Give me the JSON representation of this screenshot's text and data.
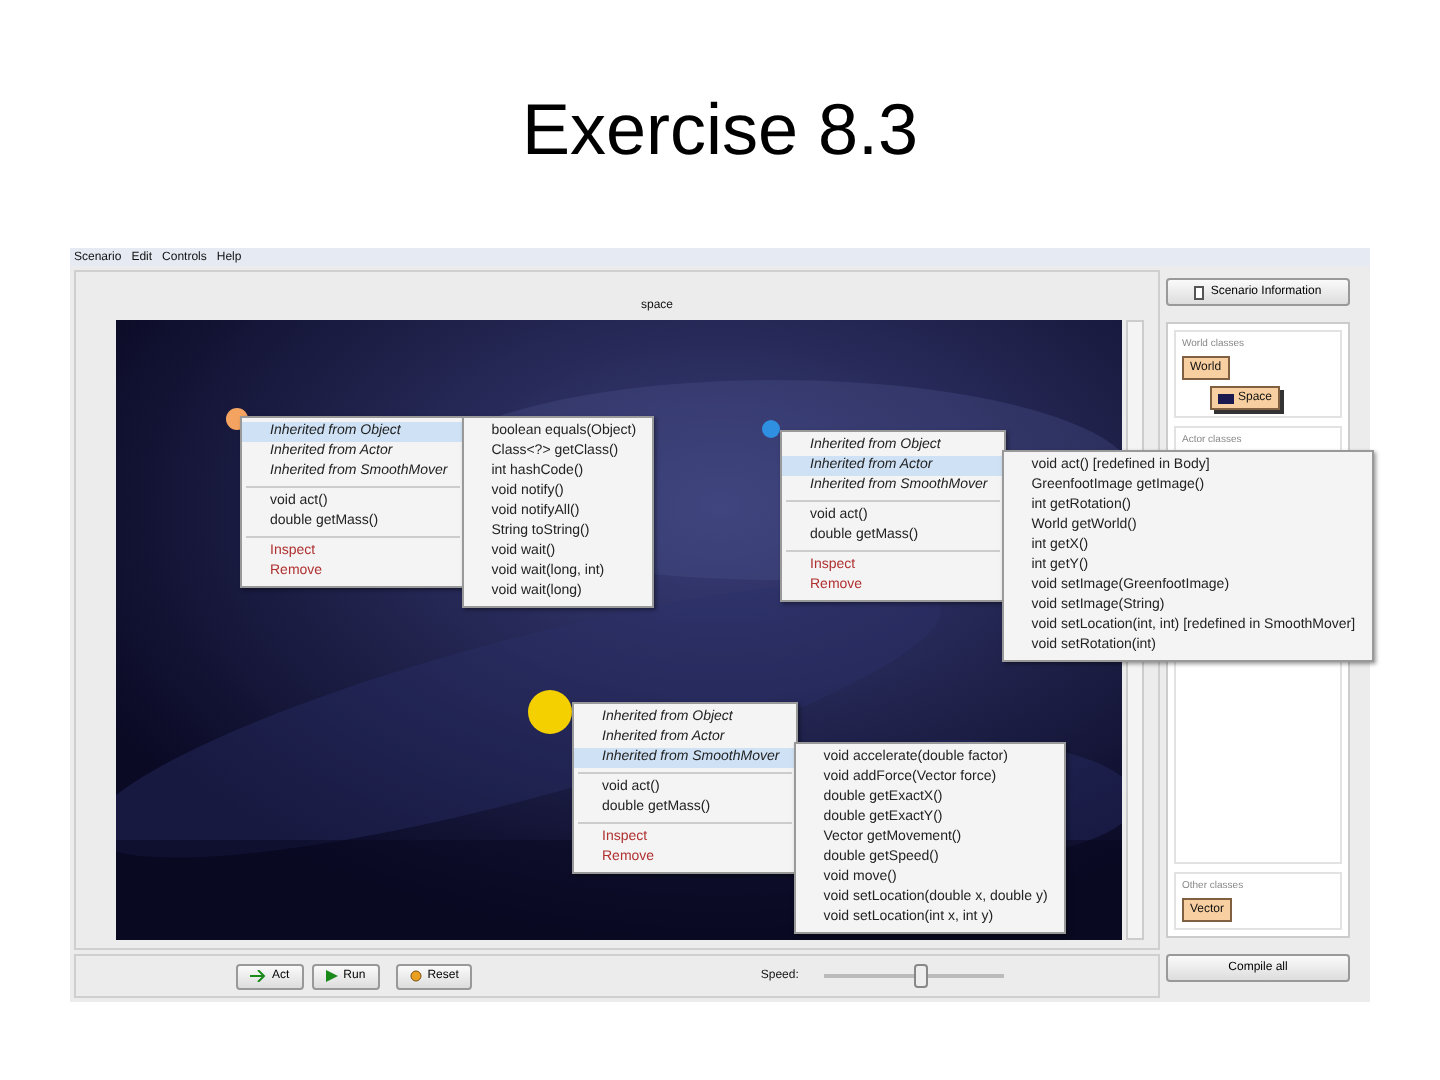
{
  "slide_title": "Exercise 8.3",
  "menu_bar": [
    "Scenario",
    "Edit",
    "Controls",
    "Help"
  ],
  "world": {
    "title": "space",
    "objects": [
      {
        "color": "#f4a460",
        "inherited": [
          {
            "label": "Inherited from Object",
            "selected": true
          },
          {
            "label": "Inherited from Actor",
            "selected": false
          },
          {
            "label": "Inherited from SmoothMover",
            "selected": false
          }
        ],
        "methods": [
          "void act()",
          "double getMass()"
        ],
        "actions": [
          "Inspect",
          "Remove"
        ],
        "submenu": [
          "boolean equals(Object)",
          "Class<?> getClass()",
          "int hashCode()",
          "void notify()",
          "void notifyAll()",
          "String toString()",
          "void wait()",
          "void wait(long, int)",
          "void wait(long)"
        ]
      },
      {
        "color": "#2f8fe0",
        "inherited": [
          {
            "label": "Inherited from Object",
            "selected": false
          },
          {
            "label": "Inherited from Actor",
            "selected": true
          },
          {
            "label": "Inherited from SmoothMover",
            "selected": false
          }
        ],
        "methods": [
          "void act()",
          "double getMass()"
        ],
        "actions": [
          "Inspect",
          "Remove"
        ],
        "submenu": [
          "void act()   [redefined in Body]",
          "GreenfootImage getImage()",
          "int getRotation()",
          "World getWorld()",
          "int getX()",
          "int getY()",
          "void setImage(GreenfootImage)",
          "void setImage(String)",
          "void setLocation(int, int)   [redefined in SmoothMover]",
          "void setRotation(int)"
        ]
      },
      {
        "color": "#f5d000",
        "inherited": [
          {
            "label": "Inherited from Object",
            "selected": false
          },
          {
            "label": "Inherited from Actor",
            "selected": false
          },
          {
            "label": "Inherited from SmoothMover",
            "selected": true
          }
        ],
        "methods": [
          "void act()",
          "double getMass()"
        ],
        "actions": [
          "Inspect",
          "Remove"
        ],
        "submenu": [
          "void accelerate(double factor)",
          "void addForce(Vector force)",
          "double getExactX()",
          "double getExactY()",
          "Vector getMovement()",
          "double getSpeed()",
          "void move()",
          "void setLocation(double x, double y)",
          "void setLocation(int x, int y)"
        ]
      }
    ]
  },
  "controls": {
    "buttons": [
      {
        "kind": "step",
        "label": "Act"
      },
      {
        "kind": "run",
        "label": "Run"
      },
      {
        "kind": "reset",
        "label": "Reset"
      }
    ],
    "speed": {
      "label": "Speed:",
      "level": 0.53
    }
  },
  "side_panel": {
    "info_button": "Scenario Information",
    "groups": [
      {
        "title": "World classes",
        "classes": [
          {
            "name": "World",
            "children": [
              {
                "name": "Space"
              }
            ]
          }
        ]
      },
      {
        "title": "Actor classes"
      },
      {
        "title": "Other classes",
        "classes": [
          {
            "name": "Vector"
          }
        ]
      }
    ],
    "compile_button": "Compile all"
  }
}
